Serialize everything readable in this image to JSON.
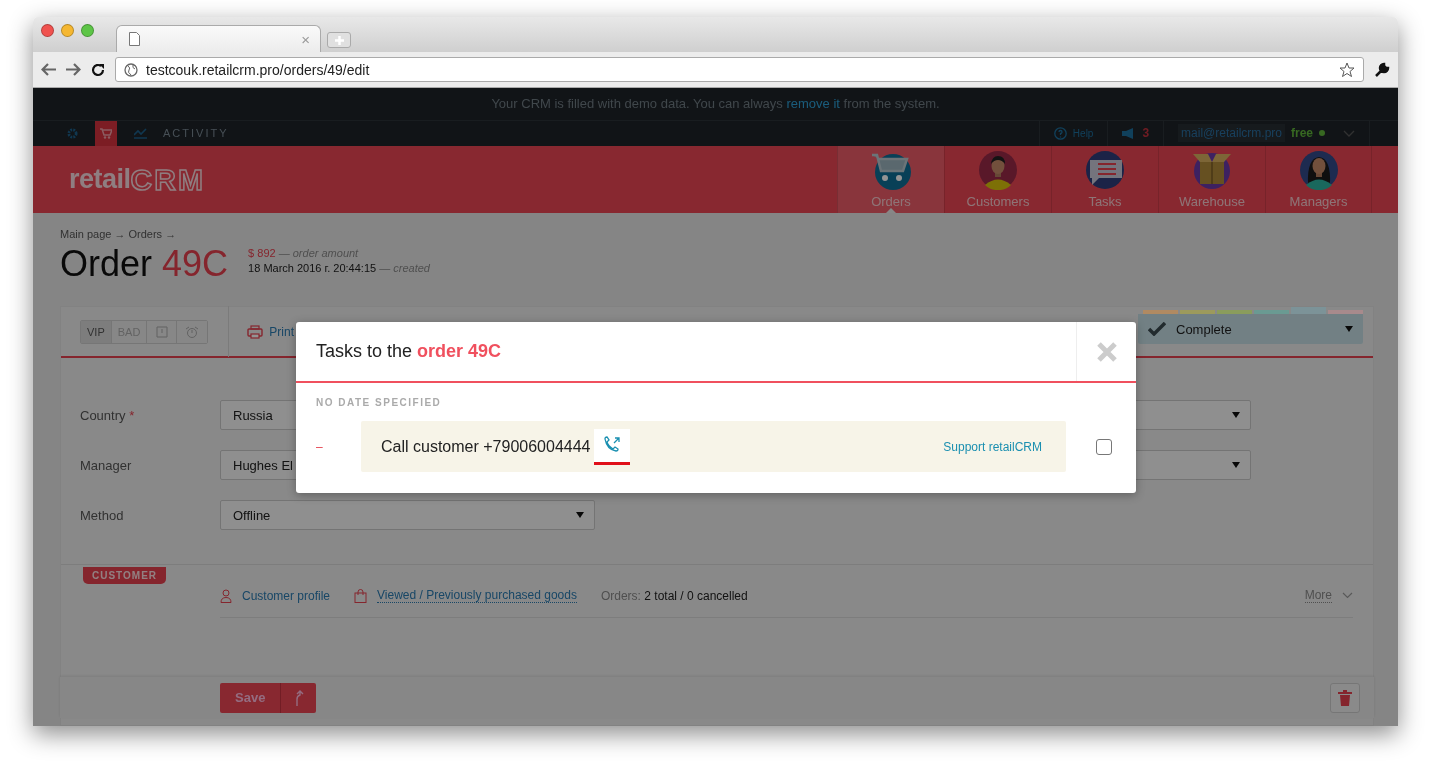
{
  "browser": {
    "tab_close": "×",
    "url": "testcouk.retailcrm.pro/orders/49/edit"
  },
  "banner": {
    "before": "Your CRM is filled with demo data. You can always ",
    "link": "remove it",
    "after": " from the system."
  },
  "topbar": {
    "tools": [
      {
        "kind": "settings",
        "selected": false
      },
      {
        "kind": "orders",
        "selected": true
      },
      {
        "kind": "analytics",
        "selected": false
      }
    ],
    "activity": "ACTIVITY",
    "help": "Help",
    "notifications": "3",
    "email": "mail@retailcrm.pro",
    "plan": "free"
  },
  "header": {
    "logo_main": "retail",
    "logo_accent": "CRM",
    "nav": [
      {
        "kind": "orders",
        "label": "Orders",
        "selected": true
      },
      {
        "kind": "customers",
        "label": "Customers",
        "selected": false
      },
      {
        "kind": "tasks",
        "label": "Tasks",
        "selected": false
      },
      {
        "kind": "warehouse",
        "label": "Warehouse",
        "selected": false
      },
      {
        "kind": "managers",
        "label": "Managers",
        "selected": false
      }
    ]
  },
  "breadcrumbs": "Main page → Orders →",
  "order": {
    "title": "Order",
    "number": "49C",
    "amount": "$ 892",
    "amount_note": "— order amount",
    "created": "18 March 2016 г. 20:44:15",
    "created_note": "— created"
  },
  "toolbar": {
    "flags": [
      {
        "kind": "text",
        "label": "VIP",
        "on": true
      },
      {
        "kind": "text",
        "label": "BAD",
        "on": false
      },
      {
        "kind": "alert",
        "on": false
      },
      {
        "kind": "clock",
        "on": false
      }
    ],
    "print": "Print",
    "status": {
      "label": "Complete",
      "stages": [
        {
          "color": "#b08a62",
          "selected": false
        },
        {
          "color": "#9c9a5c",
          "selected": false
        },
        {
          "color": "#8a9c5c",
          "selected": false
        },
        {
          "color": "#6a9a92",
          "selected": false
        },
        {
          "color": "#7c9398",
          "selected": true
        },
        {
          "color": "#a88a8c",
          "selected": false
        }
      ]
    }
  },
  "form": [
    {
      "label": "Country",
      "mark": "*",
      "value": "Russia",
      "right_field": true
    },
    {
      "label": "Manager",
      "value": "Hughes El",
      "right_field": true
    },
    {
      "label": "Method",
      "value": "Offline",
      "right_field": false
    }
  ],
  "customer": {
    "tag": "CUSTOMER",
    "profile": "Customer profile",
    "goods": "Viewed / Previously purchased goods",
    "orders_label": "Orders:",
    "orders_value": "2 total / 0 cancelled",
    "more": "More"
  },
  "bottom_bar": {
    "save": "Save"
  },
  "modal": {
    "title": "Tasks to the **order 49C**",
    "section": "NO DATE SPECIFIED",
    "tasks": [
      {
        "time": "–",
        "text": "Call customer +79006004444",
        "author": "Support retailCRM",
        "checked": false
      }
    ]
  }
}
